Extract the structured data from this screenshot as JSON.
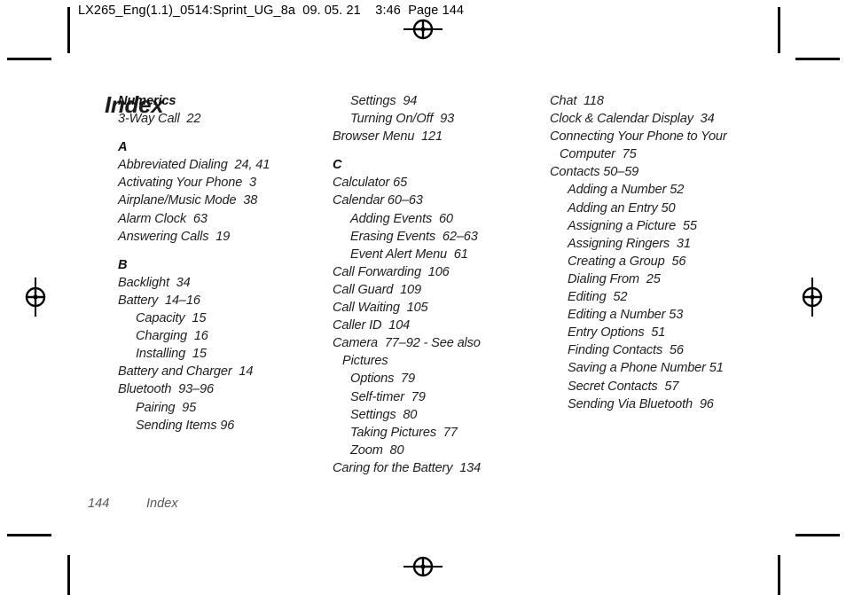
{
  "header": {
    "slug": "LX265_Eng(1.1)_0514:Sprint_UG_8a  09. 05. 21    3:46  Page 144"
  },
  "page": {
    "title": "Index",
    "footer_page_number": "144",
    "footer_label": "Index"
  },
  "marks": {
    "registration_top": "registration-target-icon",
    "registration_bottom": "registration-target-icon",
    "registration_left": "registration-target-icon",
    "registration_right": "registration-target-icon",
    "crop_mark": "crop-mark"
  },
  "columns": [
    {
      "id": "column-1",
      "entries": [
        {
          "type": "letter",
          "text": "Numerics"
        },
        {
          "type": "main",
          "text": "3-Way Call  22"
        },
        {
          "type": "letter",
          "text": "A"
        },
        {
          "type": "main",
          "text": "Abbreviated Dialing  24, 41"
        },
        {
          "type": "main",
          "text": "Activating Your Phone  3"
        },
        {
          "type": "main",
          "text": "Airplane/Music Mode  38"
        },
        {
          "type": "main",
          "text": "Alarm Clock  63"
        },
        {
          "type": "main",
          "text": "Answering Calls  19"
        },
        {
          "type": "letter",
          "text": "B"
        },
        {
          "type": "main",
          "text": "Backlight  34"
        },
        {
          "type": "main",
          "text": "Battery  14–16"
        },
        {
          "type": "sub",
          "text": "Capacity  15"
        },
        {
          "type": "sub",
          "text": "Charging  16"
        },
        {
          "type": "sub",
          "text": "Installing  15"
        },
        {
          "type": "main",
          "text": "Battery and Charger  14"
        },
        {
          "type": "main",
          "text": "Bluetooth  93–96"
        },
        {
          "type": "sub",
          "text": "Pairing  95"
        },
        {
          "type": "sub",
          "text": "Sending Items 96"
        }
      ]
    },
    {
      "id": "column-2",
      "entries": [
        {
          "type": "sub",
          "text": "Settings  94"
        },
        {
          "type": "sub",
          "text": "Turning On/Off  93"
        },
        {
          "type": "main",
          "text": "Browser Menu  121"
        },
        {
          "type": "letter",
          "text": "C"
        },
        {
          "type": "main",
          "text": "Calculator 65"
        },
        {
          "type": "main",
          "text": "Calendar 60–63"
        },
        {
          "type": "sub",
          "text": "Adding Events  60"
        },
        {
          "type": "sub",
          "text": "Erasing Events  62–63"
        },
        {
          "type": "sub",
          "text": "Event Alert Menu  61"
        },
        {
          "type": "main",
          "text": "Call Forwarding  106"
        },
        {
          "type": "main",
          "text": "Call Guard  109"
        },
        {
          "type": "main",
          "text": "Call Waiting  105"
        },
        {
          "type": "main",
          "text": "Caller ID  104"
        },
        {
          "type": "main",
          "text": "Camera  77–92 - See also"
        },
        {
          "type": "cont",
          "text": "Pictures"
        },
        {
          "type": "sub",
          "text": "Options  79"
        },
        {
          "type": "sub",
          "text": "Self-timer  79"
        },
        {
          "type": "sub",
          "text": "Settings  80"
        },
        {
          "type": "sub",
          "text": "Taking Pictures  77"
        },
        {
          "type": "sub",
          "text": "Zoom  80"
        },
        {
          "type": "main",
          "text": "Caring for the Battery  134"
        }
      ]
    },
    {
      "id": "column-3",
      "entries": [
        {
          "type": "main",
          "text": "Chat  118"
        },
        {
          "type": "main",
          "text": "Clock & Calendar Display  34"
        },
        {
          "type": "main",
          "text": "Connecting Your Phone to Your"
        },
        {
          "type": "cont",
          "text": "Computer  75"
        },
        {
          "type": "main",
          "text": "Contacts 50–59"
        },
        {
          "type": "sub",
          "text": "Adding a Number 52"
        },
        {
          "type": "sub",
          "text": "Adding an Entry 50"
        },
        {
          "type": "sub",
          "text": "Assigning a Picture  55"
        },
        {
          "type": "sub",
          "text": "Assigning Ringers  31"
        },
        {
          "type": "sub",
          "text": "Creating a Group  56"
        },
        {
          "type": "sub",
          "text": "Dialing From  25"
        },
        {
          "type": "sub",
          "text": "Editing  52"
        },
        {
          "type": "sub",
          "text": "Editing a Number 53"
        },
        {
          "type": "sub",
          "text": "Entry Options  51"
        },
        {
          "type": "sub",
          "text": "Finding Contacts  56"
        },
        {
          "type": "sub",
          "text": "Saving a Phone Number 51"
        },
        {
          "type": "sub",
          "text": "Secret Contacts  57"
        },
        {
          "type": "sub",
          "text": "Sending Via Bluetooth  96"
        }
      ]
    }
  ]
}
